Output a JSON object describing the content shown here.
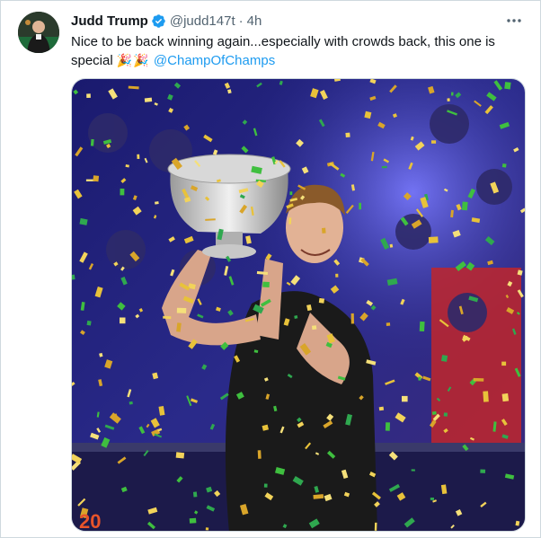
{
  "tweet": {
    "author_name": "Judd Trump",
    "handle": "@judd147t",
    "separator": "·",
    "time": "4h",
    "text_main": "Nice to be back winning again...especially with crowds back, this one is special",
    "emoji": "🎉🎉",
    "mention": "@ChampOfChamps",
    "verified": true,
    "icons": {
      "verified": "verified-badge-icon",
      "more": "more-options-icon"
    },
    "colors": {
      "link": "#1d9bf0",
      "verified": "#1d9bf0",
      "secondary_text": "#536471",
      "border": "#cfd9de"
    }
  },
  "media": {
    "description_icon": "trophy-celebration-photo",
    "signage_text": "20"
  }
}
